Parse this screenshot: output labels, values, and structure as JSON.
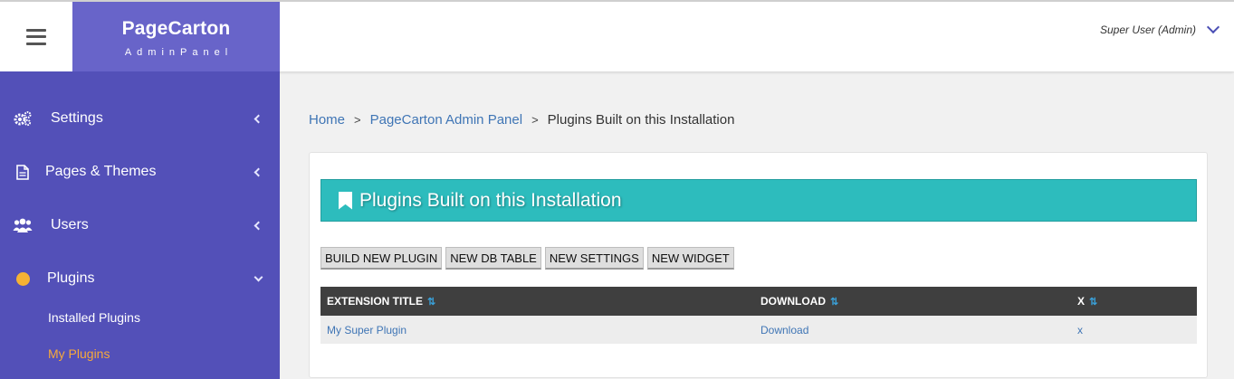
{
  "brand": {
    "name": "PageCarton",
    "subtitle": "AdminPanel"
  },
  "user": {
    "name": "Super User (Admin)"
  },
  "sidebar": {
    "items": [
      {
        "label": "Settings",
        "icon": "gears-icon"
      },
      {
        "label": "Pages & Themes",
        "icon": "document-icon"
      },
      {
        "label": "Users",
        "icon": "users-icon"
      },
      {
        "label": "Plugins",
        "icon": "dot-icon"
      }
    ],
    "subitems": [
      {
        "label": "Installed Plugins",
        "active": false
      },
      {
        "label": "My Plugins",
        "active": true
      }
    ]
  },
  "breadcrumb": {
    "items": [
      "Home",
      "PageCarton Admin Panel"
    ],
    "separator": ">",
    "current": "Plugins Built on this Installation"
  },
  "panel": {
    "title": "Plugins Built on this Installation",
    "buttons": [
      "BUILD NEW PLUGIN",
      "NEW DB TABLE",
      "NEW SETTINGS",
      "NEW WIDGET"
    ],
    "table": {
      "sort_glyph": "⇅",
      "columns": [
        "EXTENSION TITLE",
        "DOWNLOAD",
        "X"
      ],
      "rows": [
        {
          "title": "My Super Plugin",
          "download": "Download",
          "x": "x"
        }
      ]
    }
  },
  "colors": {
    "sidebar": "#5350b8",
    "brand": "#6864c9",
    "header_box": "#2dbcbd",
    "accent_orange": "#f7a93b",
    "link": "#3f75b5"
  }
}
